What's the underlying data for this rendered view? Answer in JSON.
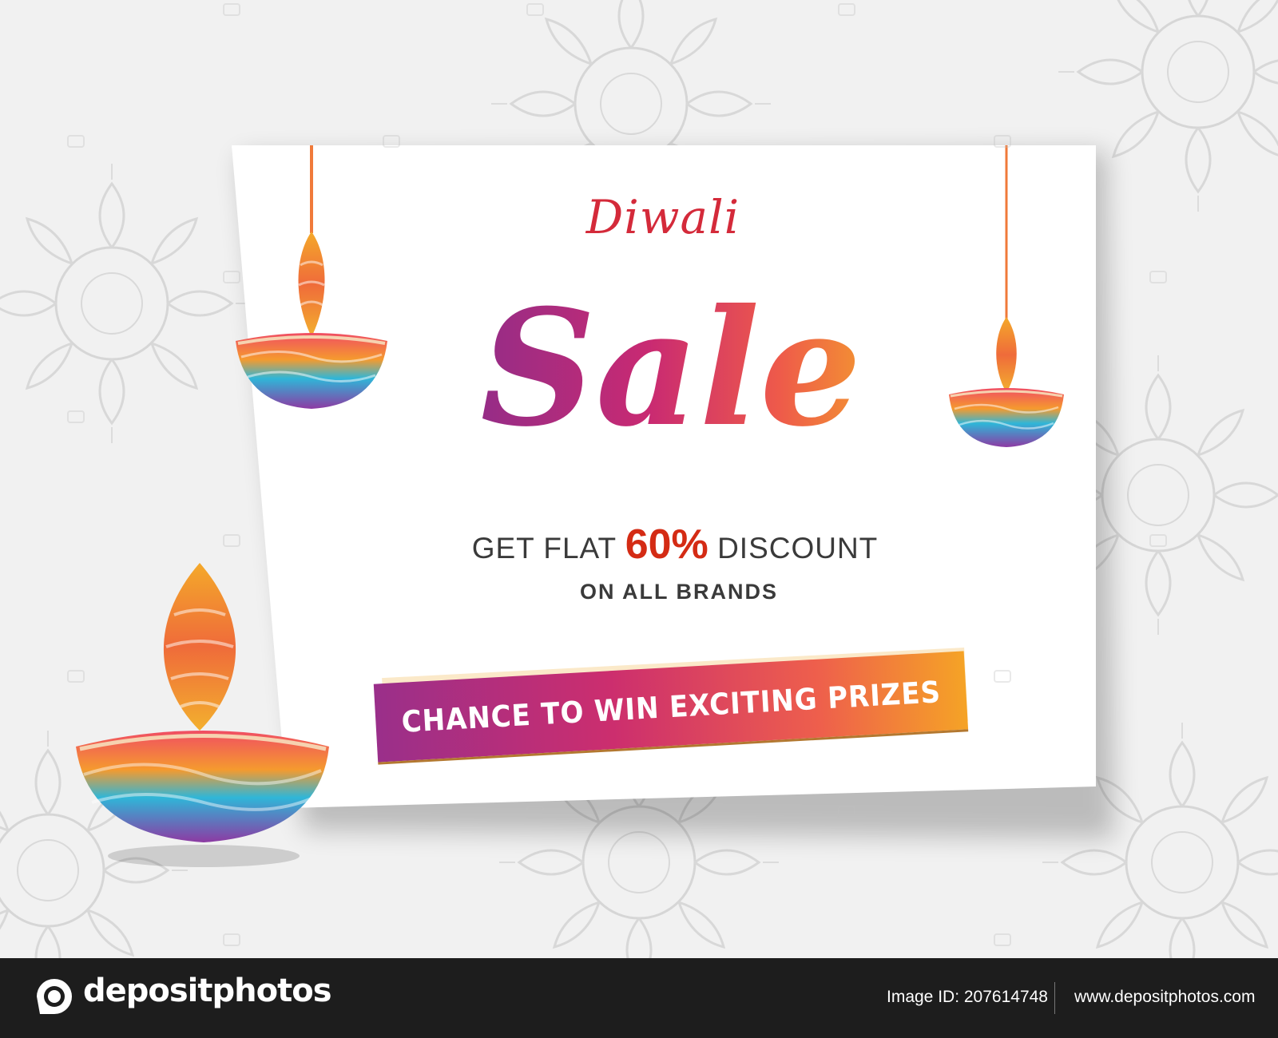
{
  "banner": {
    "script_title": "Diwali",
    "main_title": "Sale",
    "offer_prefix": "GET FLAT",
    "offer_percent": "60%",
    "offer_suffix": "DISCOUNT",
    "subline": "ON ALL BRANDS",
    "prize_label": "CHANCE TO WIN EXCITING PRIZES"
  },
  "icons": {
    "hanging_lamp": "hanging-diya-icon",
    "standing_lamp": "diya-icon",
    "background": "mandala-pattern",
    "logo": "camera-logo-icon"
  },
  "colors": {
    "background": "#f1f1f1",
    "card": "#ffffff",
    "script_red": "#d42a3a",
    "percent_red": "#d42b14",
    "gradient_purple": "#8e2d8a",
    "gradient_pink": "#cc2e6e",
    "gradient_orange": "#f5a326",
    "footer": "#1d1d1d"
  },
  "footer": {
    "brand": "depositphotos",
    "image_id": "Image ID: 207614748",
    "url": "www.depositphotos.com"
  }
}
